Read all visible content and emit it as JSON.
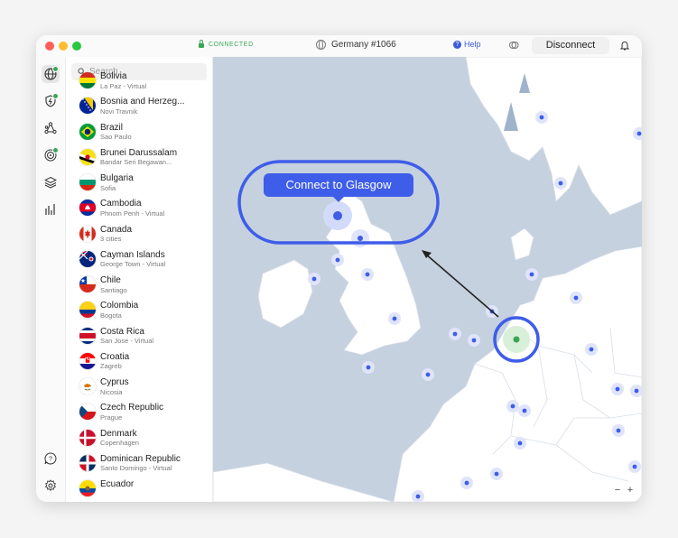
{
  "titlebar": {
    "status": "CONNECTED",
    "server": "Germany #1066",
    "help_label": "Help",
    "disconnect_label": "Disconnect"
  },
  "search": {
    "placeholder": "Search"
  },
  "countries": [
    {
      "name": "Bolivia",
      "sub": "La Paz - Virtual",
      "flag": "bolivia"
    },
    {
      "name": "Bosnia and Herzeg...",
      "sub": "Novi Travnik",
      "flag": "bosnia"
    },
    {
      "name": "Brazil",
      "sub": "Sao Paulo",
      "flag": "brazil"
    },
    {
      "name": "Brunei Darussalam",
      "sub": "Bandar Seri Begawan...",
      "flag": "brunei"
    },
    {
      "name": "Bulgaria",
      "sub": "Sofia",
      "flag": "bulgaria"
    },
    {
      "name": "Cambodia",
      "sub": "Phnom Penh - Virtual",
      "flag": "cambodia"
    },
    {
      "name": "Canada",
      "sub": "3 cities",
      "flag": "canada"
    },
    {
      "name": "Cayman Islands",
      "sub": "George Town - Virtual",
      "flag": "cayman"
    },
    {
      "name": "Chile",
      "sub": "Santiago",
      "flag": "chile"
    },
    {
      "name": "Colombia",
      "sub": "Bogota",
      "flag": "colombia"
    },
    {
      "name": "Costa Rica",
      "sub": "San Jose - Virtual",
      "flag": "costarica"
    },
    {
      "name": "Croatia",
      "sub": "Zagreb",
      "flag": "croatia"
    },
    {
      "name": "Cyprus",
      "sub": "Nicosia",
      "flag": "cyprus"
    },
    {
      "name": "Czech Republic",
      "sub": "Prague",
      "flag": "czech"
    },
    {
      "name": "Denmark",
      "sub": "Copenhagen",
      "flag": "denmark"
    },
    {
      "name": "Dominican Republic",
      "sub": "Santo Domingo - Virtual",
      "flag": "dominican"
    },
    {
      "name": "Ecuador",
      "sub": "",
      "flag": "ecuador"
    }
  ],
  "map": {
    "tooltip": "Connect to Glasgow",
    "zoom_minus": "−",
    "zoom_plus": "+"
  },
  "colors": {
    "accent": "#3e5de9",
    "connected": "#3aa655",
    "sea": "#c5d1df",
    "land": "#ffffff"
  }
}
